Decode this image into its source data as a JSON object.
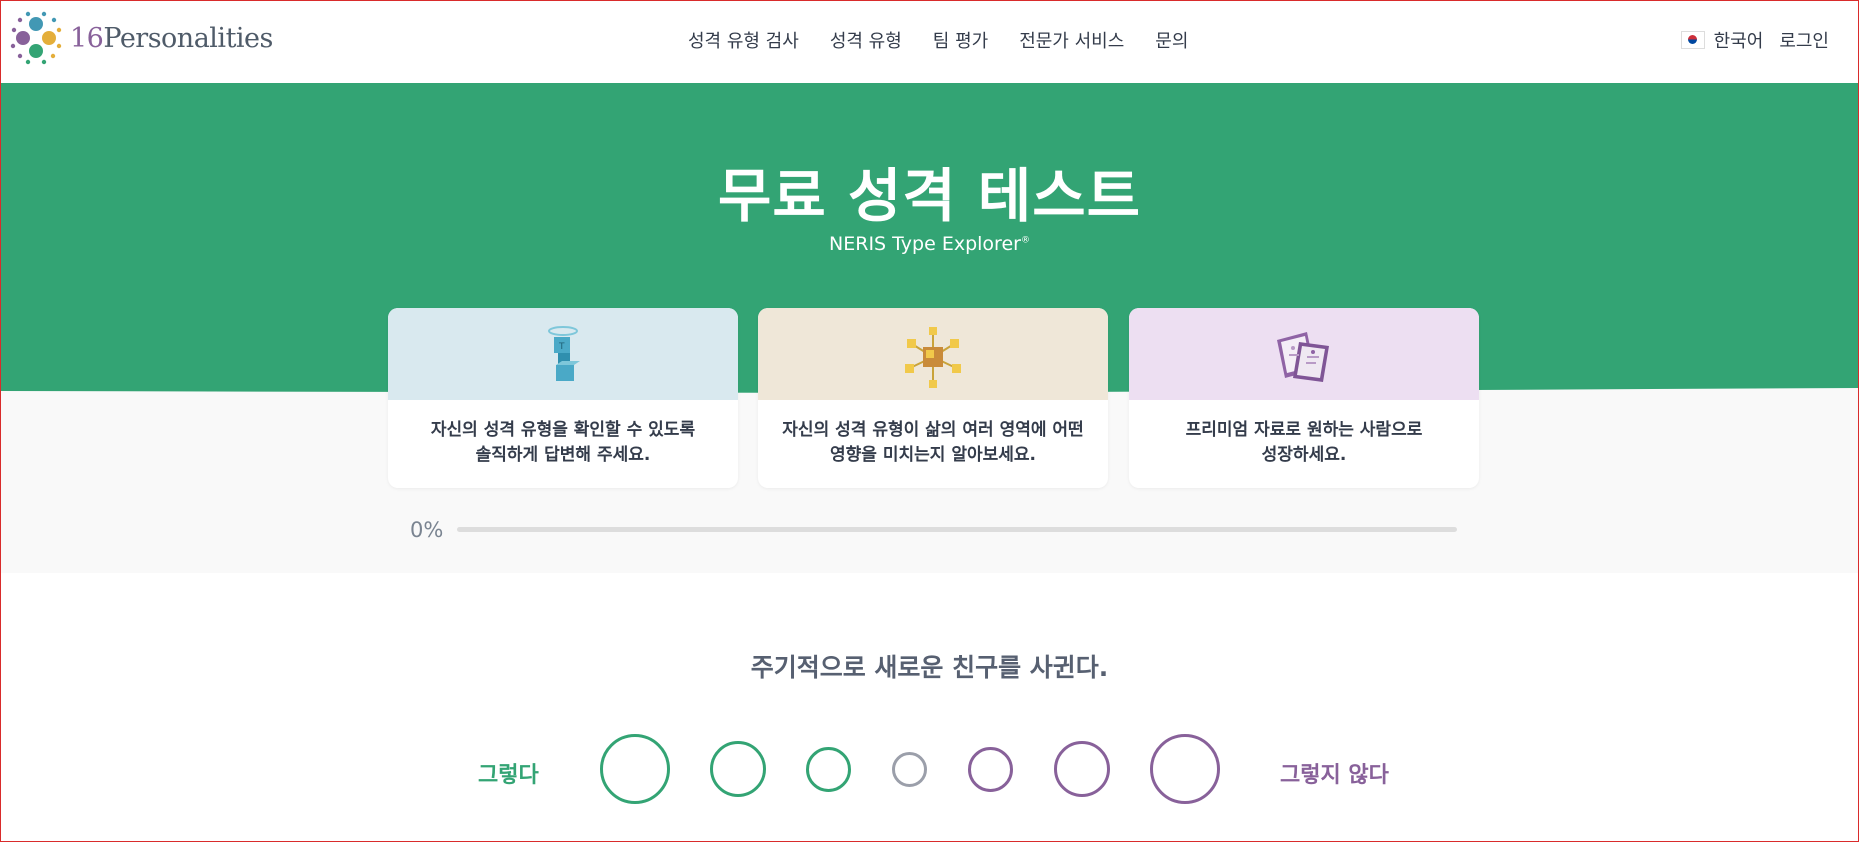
{
  "header": {
    "logo_number": "16",
    "logo_word": "Personalities",
    "nav": [
      "성격 유형 검사",
      "성격 유형",
      "팀 평가",
      "전문가 서비스",
      "문의"
    ],
    "language": "한국어",
    "login": "로그인",
    "flag_icon": "korea-flag-icon"
  },
  "hero": {
    "title": "무료 성격 테스트",
    "subtitle": "NERIS Type Explorer",
    "subtitle_mark": "®",
    "background_color": "#33a474",
    "cards": [
      {
        "icon": "cube-figure-icon",
        "line1": "자신의 성격 유형을 확인할 수 있도록",
        "line2": "솔직하게 답변해 주세요.",
        "color": "#d9e9ef"
      },
      {
        "icon": "network-cubes-icon",
        "line1": "자신의 성격 유형이 삶의 여러 영역에 어떤",
        "line2": "영향을 미치는지 알아보세요.",
        "color": "#efe7d8"
      },
      {
        "icon": "premium-cards-icon",
        "line1": "프리미엄 자료로 원하는 사람으로",
        "line2": "성장하세요.",
        "color": "#eddff2"
      }
    ]
  },
  "progress": {
    "label": "0%",
    "value": 0
  },
  "question": {
    "text": "주기적으로 새로운 친구를 사귄다.",
    "agree_label": "그렇다",
    "disagree_label": "그렇지 않다",
    "agree_color": "#33a474",
    "neutral_color": "#9b9faa",
    "disagree_color": "#88619a",
    "options_count": 7
  }
}
